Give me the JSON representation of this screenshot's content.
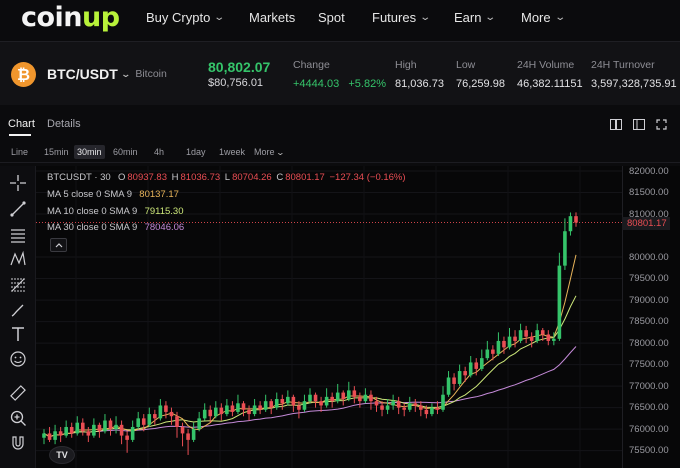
{
  "nav": {
    "logo_main": "coin",
    "logo_accent": "up",
    "items": [
      {
        "label": "Buy Crypto",
        "dropdown": true
      },
      {
        "label": "Markets",
        "dropdown": false
      },
      {
        "label": "Spot",
        "dropdown": false
      },
      {
        "label": "Futures",
        "dropdown": true
      },
      {
        "label": "Earn",
        "dropdown": true
      },
      {
        "label": "More",
        "dropdown": true
      }
    ]
  },
  "ticker": {
    "coin_symbol": "₿",
    "pair": "BTC/USDT",
    "coin_name": "Bitcoin",
    "price": "80,802.07",
    "price_usd": "$80,756.01",
    "change_label": "Change",
    "change_value": "+4444.03",
    "change_pct": "+5.82%",
    "high_label": "High",
    "high_value": "81,036.73",
    "low_label": "Low",
    "low_value": "76,259.98",
    "volume_label": "24H Volume",
    "volume_value": "46,382.11151",
    "turnover_label": "24H Turnover",
    "turnover_value": "3,597,328,735.91"
  },
  "tabs": {
    "chart": "Chart",
    "details": "Details"
  },
  "timeframes": [
    "Line",
    "15min",
    "30min",
    "60min",
    "4h",
    "1day",
    "1week",
    "More"
  ],
  "active_timeframe": "30min",
  "legend": {
    "symbol": "BTCUSDT · 30",
    "o_label": "O",
    "o": "80937.83",
    "h_label": "H",
    "h": "81036.73",
    "l_label": "L",
    "l": "80704.26",
    "c_label": "C",
    "c": "80801.17",
    "change": "−127.34 (−0.16%)",
    "ma5_label": "MA 5 close 0 SMA 9",
    "ma5_value": "80137.17",
    "ma10_label": "MA 10 close 0 SMA 9",
    "ma10_value": "79115.30",
    "ma30_label": "MA 30 close 0 SMA 9",
    "ma30_value": "78046.06"
  },
  "price_axis": {
    "labels": [
      "82000.00",
      "81500.00",
      "81000.00",
      "80801.17",
      "80000.00",
      "79500.00",
      "79000.00",
      "78500.00",
      "78000.00",
      "77500.00",
      "77000.00",
      "76500.00",
      "76000.00",
      "75500.00"
    ],
    "current": "80801.17"
  },
  "tv_logo": "TV",
  "colors": {
    "up": "#35c46a",
    "down": "#ea4e54",
    "ma5": "#e8b45a",
    "ma10": "#cde87a",
    "ma30": "#c48ad8",
    "brand_accent": "#b8f23a"
  },
  "chart_data": {
    "type": "candlestick",
    "ylim": [
      75200,
      82000
    ],
    "y_ticks": [
      82000,
      81500,
      81000,
      80000,
      79500,
      79000,
      78500,
      78000,
      77500,
      77000,
      76500,
      76000,
      75500
    ],
    "current_price": 80801.17,
    "candles": [
      [
        75800,
        75900,
        75650,
        76000
      ],
      [
        75900,
        75750,
        75700,
        76050
      ],
      [
        75750,
        75950,
        75650,
        76100
      ],
      [
        75950,
        75850,
        75700,
        76050
      ],
      [
        75850,
        76050,
        75800,
        76200
      ],
      [
        76050,
        75900,
        75800,
        76150
      ],
      [
        75900,
        76150,
        75850,
        76300
      ],
      [
        76150,
        75950,
        75850,
        76250
      ],
      [
        75950,
        75850,
        75700,
        76050
      ],
      [
        75850,
        76100,
        75800,
        76250
      ],
      [
        76100,
        75950,
        75800,
        76150
      ],
      [
        75950,
        76200,
        75900,
        76350
      ],
      [
        76200,
        76000,
        75850,
        76250
      ],
      [
        76000,
        76100,
        75900,
        76300
      ],
      [
        76100,
        75850,
        75650,
        76200
      ],
      [
        75850,
        75750,
        75450,
        75950
      ],
      [
        75750,
        76050,
        75700,
        76200
      ],
      [
        76050,
        76250,
        76000,
        76400
      ],
      [
        76250,
        76100,
        75950,
        76350
      ],
      [
        76100,
        76350,
        76050,
        76500
      ],
      [
        76350,
        76250,
        76100,
        76450
      ],
      [
        76250,
        76550,
        76200,
        76700
      ],
      [
        76550,
        76400,
        76250,
        76650
      ],
      [
        76400,
        76300,
        76100,
        76500
      ],
      [
        76300,
        76050,
        75800,
        76400
      ],
      [
        76050,
        75900,
        75600,
        76150
      ],
      [
        75900,
        75750,
        75400,
        76000
      ],
      [
        75750,
        76000,
        75700,
        76150
      ],
      [
        76000,
        76250,
        75950,
        76400
      ],
      [
        76250,
        76450,
        76200,
        76600
      ],
      [
        76450,
        76300,
        76150,
        76550
      ],
      [
        76300,
        76500,
        76250,
        76650
      ],
      [
        76500,
        76350,
        76200,
        76600
      ],
      [
        76350,
        76550,
        76300,
        76700
      ],
      [
        76550,
        76400,
        76300,
        76650
      ],
      [
        76400,
        76600,
        76350,
        76800
      ],
      [
        76600,
        76450,
        76300,
        76650
      ],
      [
        76450,
        76350,
        76200,
        76550
      ],
      [
        76350,
        76550,
        76300,
        76700
      ],
      [
        76550,
        76450,
        76350,
        76650
      ],
      [
        76450,
        76650,
        76400,
        76800
      ],
      [
        76650,
        76500,
        76350,
        76700
      ],
      [
        76500,
        76700,
        76450,
        76850
      ],
      [
        76700,
        76600,
        76450,
        76800
      ],
      [
        76600,
        76750,
        76550,
        76900
      ],
      [
        76750,
        76550,
        76400,
        76800
      ],
      [
        76550,
        76450,
        76250,
        76650
      ],
      [
        76450,
        76650,
        76400,
        76800
      ],
      [
        76650,
        76800,
        76600,
        76950
      ],
      [
        76800,
        76650,
        76500,
        76850
      ],
      [
        76650,
        76550,
        76400,
        76750
      ],
      [
        76550,
        76750,
        76500,
        76950
      ],
      [
        76750,
        76650,
        76500,
        76850
      ],
      [
        76650,
        76850,
        76600,
        77050
      ],
      [
        76850,
        76700,
        76550,
        76900
      ],
      [
        76700,
        76900,
        76650,
        77100
      ],
      [
        76900,
        76750,
        76600,
        77000
      ],
      [
        76750,
        76650,
        76500,
        76850
      ],
      [
        76650,
        76800,
        76600,
        76950
      ],
      [
        76800,
        76650,
        76450,
        76900
      ],
      [
        76650,
        76550,
        76400,
        76750
      ],
      [
        76550,
        76450,
        76300,
        76650
      ],
      [
        76450,
        76550,
        76350,
        76700
      ],
      [
        76550,
        76650,
        76450,
        76800
      ],
      [
        76650,
        76500,
        76350,
        76750
      ],
      [
        76500,
        76450,
        76300,
        76600
      ],
      [
        76450,
        76600,
        76400,
        76750
      ],
      [
        76600,
        76550,
        76400,
        76700
      ],
      [
        76550,
        76450,
        76300,
        76650
      ],
      [
        76450,
        76350,
        76250,
        76550
      ],
      [
        76350,
        76500,
        76300,
        76600
      ],
      [
        76500,
        76450,
        76350,
        76650
      ],
      [
        76450,
        76800,
        76400,
        77000
      ],
      [
        76800,
        77200,
        76750,
        77350
      ],
      [
        77200,
        77050,
        76900,
        77300
      ],
      [
        77050,
        77350,
        77000,
        77500
      ],
      [
        77350,
        77250,
        77100,
        77450
      ],
      [
        77250,
        77550,
        77200,
        77700
      ],
      [
        77550,
        77400,
        77250,
        77650
      ],
      [
        77400,
        77650,
        77350,
        77850
      ],
      [
        77650,
        77850,
        77600,
        78050
      ],
      [
        77850,
        77750,
        77600,
        77950
      ],
      [
        77750,
        78050,
        77700,
        78250
      ],
      [
        78050,
        77900,
        77750,
        78150
      ],
      [
        77900,
        78150,
        77850,
        78350
      ],
      [
        78150,
        78050,
        77900,
        78300
      ],
      [
        78050,
        78300,
        78000,
        78450
      ],
      [
        78300,
        78150,
        78000,
        78400
      ],
      [
        78150,
        78050,
        77900,
        78250
      ],
      [
        78050,
        78300,
        78000,
        78450
      ],
      [
        78300,
        78200,
        78050,
        78350
      ],
      [
        78200,
        78050,
        77950,
        78300
      ],
      [
        78050,
        78100,
        77950,
        78250
      ],
      [
        78100,
        79800,
        78050,
        80100
      ],
      [
        79800,
        80600,
        79700,
        80900
      ],
      [
        80600,
        80950,
        80500,
        81036
      ],
      [
        80950,
        80801,
        80704,
        81037
      ]
    ]
  }
}
